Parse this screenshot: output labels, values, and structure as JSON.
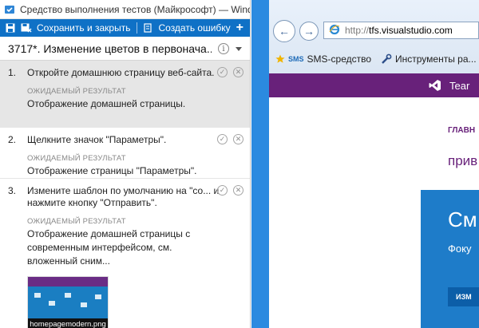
{
  "runner": {
    "window_title": "Средство выполнения тестов (Майкрософт) — Wind...",
    "toolbar": {
      "save_close_label": "Сохранить и закрыть",
      "create_bug_label": "Создать ошибку",
      "add_label": "+"
    },
    "test_case_title": "3717*. Изменение цветов в первонача...",
    "info_label": "i",
    "expected_label": "ОЖИДАЕМЫЙ РЕЗУЛЬТАТ",
    "steps": [
      {
        "num": "1.",
        "action": "Откройте домашнюю страницу веб-сайта.",
        "expected": "Отображение домашней страницы."
      },
      {
        "num": "2.",
        "action": "Щелкните значок \"Параметры\".",
        "expected": "Отображение страницы \"Параметры\"."
      },
      {
        "num": "3.",
        "action": "Измените шаблон по умолчанию на \"со... и нажмите кнопку \"Отправить\".",
        "expected": "Отображение домашней страницы с современным интерфейсом, см. вложенный сним..."
      }
    ],
    "attachment_name": "homepagemodern.png"
  },
  "browser": {
    "url_prefix": "http://",
    "url_domain": "tfs.visualstudio.com",
    "favorites": [
      {
        "label": "SMS-средство",
        "mark": "SMS"
      },
      {
        "label": "Инструменты ра..."
      }
    ],
    "page": {
      "header_text": "Tear",
      "nav_home": "ГЛАВН",
      "welcome": "прив",
      "hero_title": "См",
      "hero_sub": "Фоку",
      "hero_button": "ИЗМ"
    }
  },
  "colors": {
    "toolbar_blue": "#0f71c6",
    "vs_purple": "#68217a",
    "hero_blue": "#1e7cc9",
    "selected_step": "#e6e6e6"
  }
}
